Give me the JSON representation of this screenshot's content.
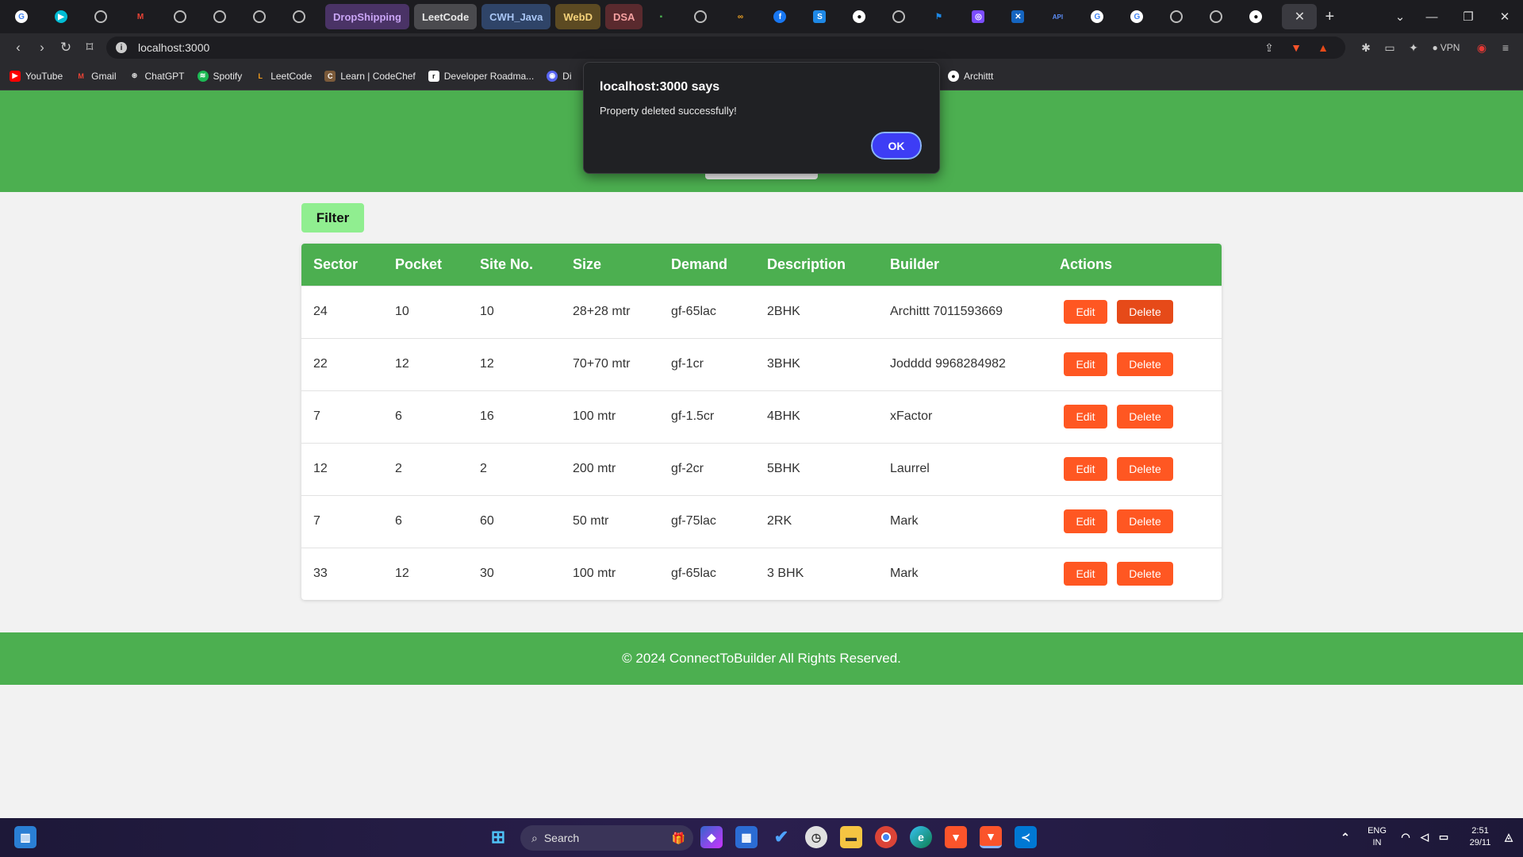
{
  "browser": {
    "tab_groups": [
      {
        "label": "DropShipping",
        "bg": "#4a3366",
        "fg": "#c9a5f5"
      },
      {
        "label": "LeetCode",
        "bg": "#4a4a4e",
        "fg": "#e8e8e8"
      },
      {
        "label": "CWH_Java",
        "bg": "#2f4468",
        "fg": "#a9c6f5"
      },
      {
        "label": "WebD",
        "bg": "#5c4a22",
        "fg": "#f5d27a"
      },
      {
        "label": "DSA",
        "bg": "#5a2a2e",
        "fg": "#f5a0a0"
      }
    ],
    "url": "localhost:3000",
    "vpn_label": "VPN",
    "bookmarks": [
      {
        "label": "YouTube",
        "color": "#ff0000",
        "glyph": "▶"
      },
      {
        "label": "Gmail",
        "color": "#ea4335",
        "glyph": "M"
      },
      {
        "label": "ChatGPT",
        "color": "#555555",
        "glyph": "⊛"
      },
      {
        "label": "Spotify",
        "color": "#1db954",
        "glyph": "≋"
      },
      {
        "label": "LeetCode",
        "color": "#f89f1b",
        "glyph": "L"
      },
      {
        "label": "Learn | CodeChef",
        "color": "#7b5a3a",
        "glyph": "C"
      },
      {
        "label": "Developer Roadma...",
        "color": "#111111",
        "glyph": "r"
      },
      {
        "label": "Di",
        "color": "#5865f2",
        "glyph": "◉"
      }
    ],
    "bookmark_right": "Archittt"
  },
  "dialog": {
    "title": "localhost:3000 says",
    "message": "Property deleted successfully!",
    "ok_label": "OK"
  },
  "page": {
    "filter_label": "Filter",
    "columns": [
      "Sector",
      "Pocket",
      "Site No.",
      "Size",
      "Demand",
      "Description",
      "Builder",
      "Actions"
    ],
    "edit_label": "Edit",
    "delete_label": "Delete",
    "rows": [
      {
        "sector": "24",
        "pocket": "10",
        "site": "10",
        "size": "28+28 mtr",
        "demand": "gf-65lac",
        "description": "2BHK",
        "builder": "Archittt 7011593669"
      },
      {
        "sector": "22",
        "pocket": "12",
        "site": "12",
        "size": "70+70 mtr",
        "demand": "gf-1cr",
        "description": "3BHK",
        "builder": "Jodddd 9968284982"
      },
      {
        "sector": "7",
        "pocket": "6",
        "site": "16",
        "size": "100 mtr",
        "demand": "gf-1.5cr",
        "description": "4BHK",
        "builder": "xFactor"
      },
      {
        "sector": "12",
        "pocket": "2",
        "site": "2",
        "size": "200 mtr",
        "demand": "gf-2cr",
        "description": "5BHK",
        "builder": "Laurrel"
      },
      {
        "sector": "7",
        "pocket": "6",
        "site": "60",
        "size": "50 mtr",
        "demand": "gf-75lac",
        "description": "2RK",
        "builder": "Mark"
      },
      {
        "sector": "33",
        "pocket": "12",
        "site": "30",
        "size": "100 mtr",
        "demand": "gf-65lac",
        "description": "3 BHK",
        "builder": "Mark"
      }
    ],
    "footer": "© 2024 ConnectToBuilder All Rights Reserved."
  },
  "taskbar": {
    "search_placeholder": "Search",
    "lang_top": "ENG",
    "lang_bottom": "IN",
    "time": "2:51",
    "date": "29/11"
  },
  "colors": {
    "header_green": "#4caf50",
    "filter_green": "#90ee90",
    "action_orange": "#ff5722",
    "dialog_ok": "#3d3df5"
  }
}
